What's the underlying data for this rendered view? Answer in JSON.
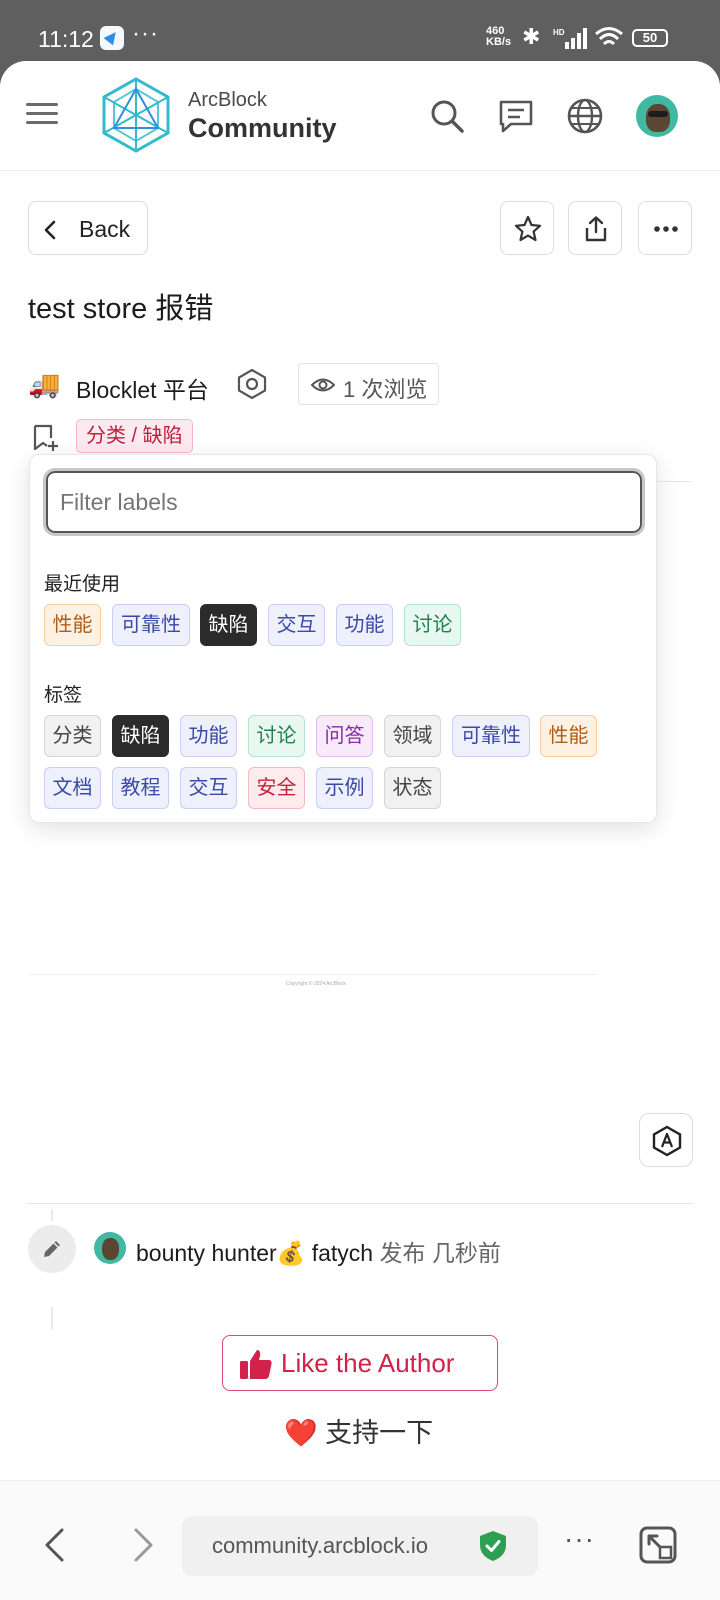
{
  "status_bar": {
    "time": "11:12",
    "dots": "···",
    "speed_top": "460",
    "speed_bottom": "KB/s",
    "battery": "50"
  },
  "header": {
    "brand_top": "ArcBlock",
    "brand_bottom": "Community",
    "icons": [
      "menu-icon",
      "search-icon",
      "chat-icon",
      "globe-icon",
      "avatar"
    ]
  },
  "toolbar": {
    "back_label": "Back",
    "actions": [
      "star-icon",
      "share-icon",
      "more-icon"
    ]
  },
  "post": {
    "title": "test store 报错",
    "category_emoji": "🚚",
    "category": "Blocklet 平台",
    "views": "1 次浏览",
    "current_label": "分类 / 缺陷"
  },
  "label_picker": {
    "placeholder": "Filter labels",
    "recent_title": "最近使用",
    "recent": [
      {
        "label": "性能",
        "style": "orange"
      },
      {
        "label": "可靠性",
        "style": "indigo"
      },
      {
        "label": "缺陷",
        "style": "dark"
      },
      {
        "label": "交互",
        "style": "indigo"
      },
      {
        "label": "功能",
        "style": "indigo"
      },
      {
        "label": "讨论",
        "style": "green"
      }
    ],
    "all_title": "标签",
    "all": [
      {
        "label": "分类",
        "style": "gray"
      },
      {
        "label": "缺陷",
        "style": "dark"
      },
      {
        "label": "功能",
        "style": "indigo"
      },
      {
        "label": "讨论",
        "style": "green"
      },
      {
        "label": "问答",
        "style": "purple"
      },
      {
        "label": "领域",
        "style": "gray"
      },
      {
        "label": "可靠性",
        "style": "indigo"
      },
      {
        "label": "性能",
        "style": "orange"
      },
      {
        "label": "文档",
        "style": "indigo"
      },
      {
        "label": "教程",
        "style": "indigo"
      },
      {
        "label": "交互",
        "style": "indigo"
      },
      {
        "label": "安全",
        "style": "red"
      },
      {
        "label": "示例",
        "style": "indigo"
      },
      {
        "label": "状态",
        "style": "gray"
      }
    ]
  },
  "copyright": "Copyright © 2024 ArcBlock",
  "activity": {
    "user": "bounty hunter💰 fatych",
    "action": "发布 几秒前"
  },
  "like": {
    "label": "Like the Author",
    "support": "支持一下",
    "support_emoji": "❤️"
  },
  "browser": {
    "url": "community.arcblock.io",
    "more": "···"
  },
  "colors": {
    "accent_red": "#d3214a",
    "logo_teal": "#2fb8c9",
    "verified_green": "#2e9e55"
  }
}
